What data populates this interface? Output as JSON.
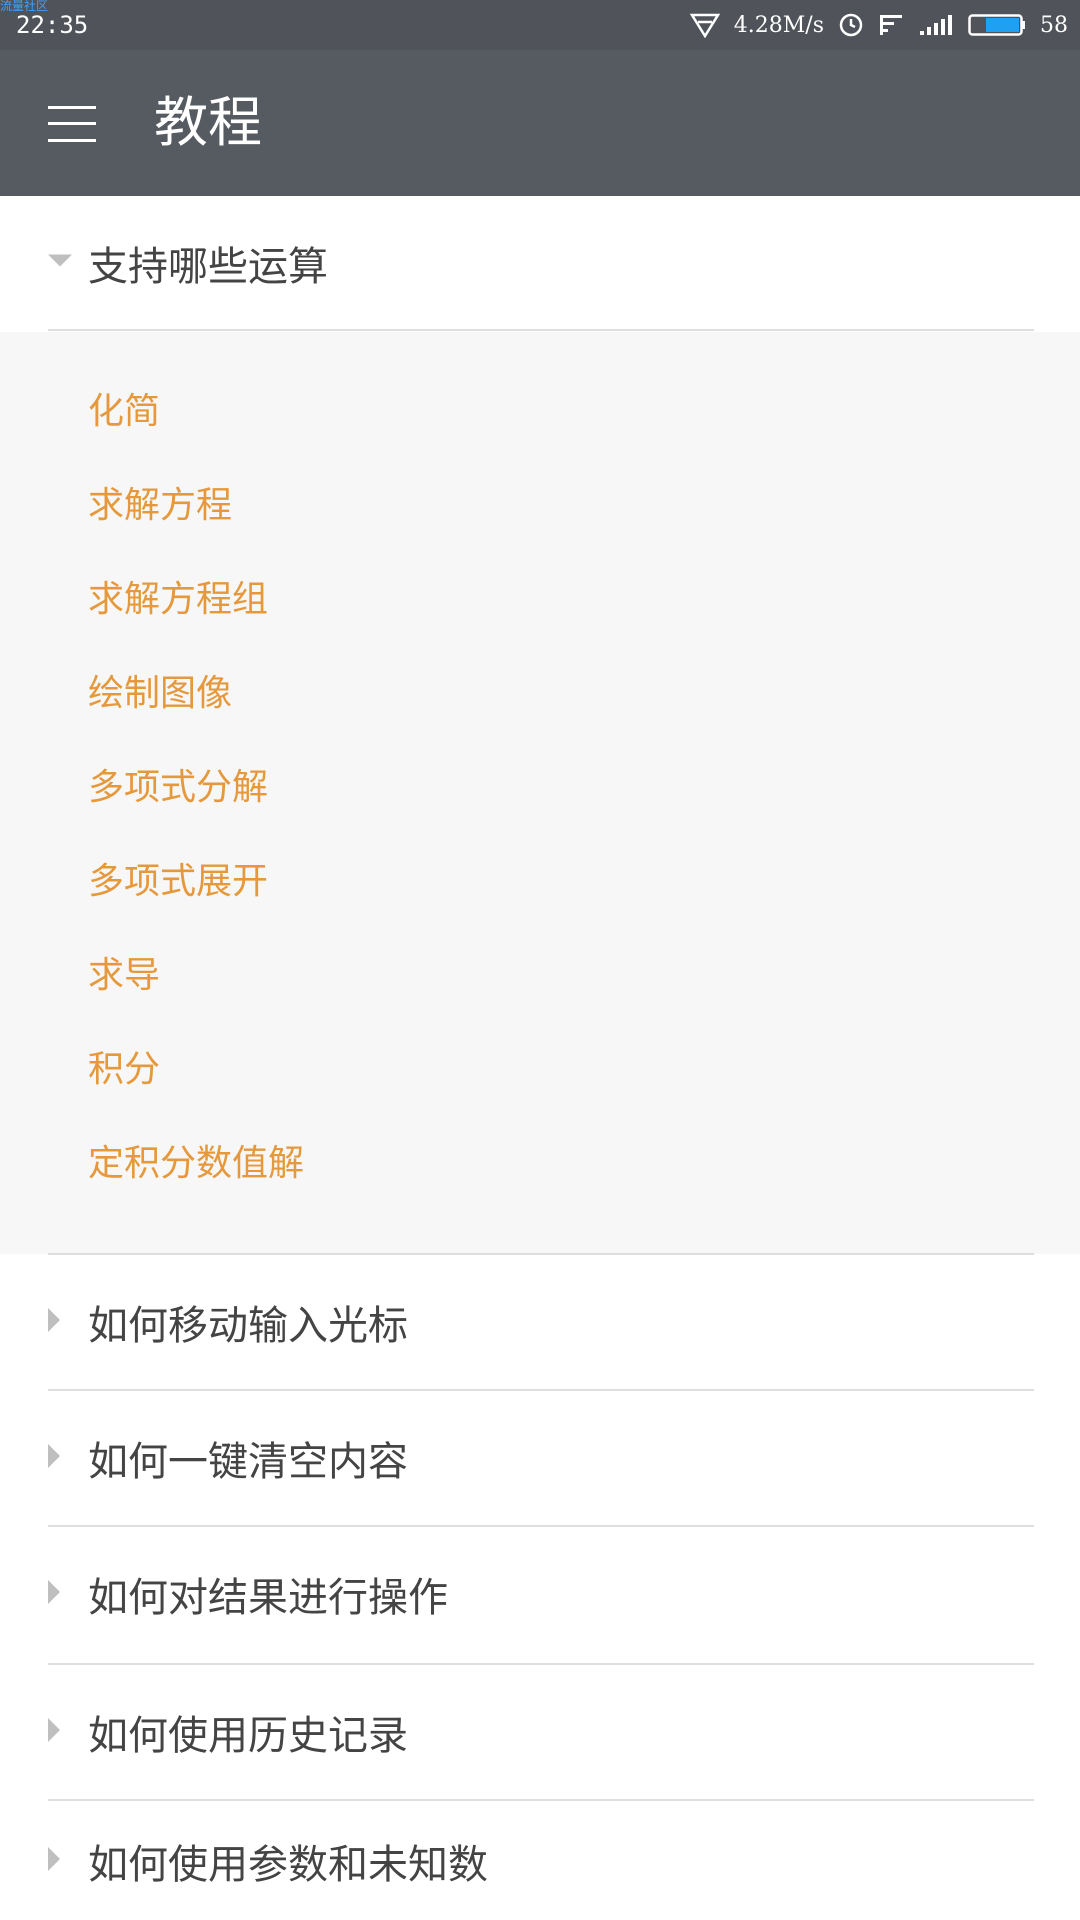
{
  "status_bar": {
    "watermark": "流量社区",
    "time": "22:35",
    "net_speed": "4.28M/s",
    "battery": "58"
  },
  "app_bar": {
    "title": "教程",
    "menu_icon": "menu-icon"
  },
  "sections": [
    {
      "label": "支持哪些运算",
      "expanded": true,
      "items": [
        "化简",
        "求解方程",
        "求解方程组",
        "绘制图像",
        "多项式分解",
        "多项式展开",
        "求导",
        "积分",
        "定积分数值解"
      ]
    },
    {
      "label": "如何移动输入光标",
      "expanded": false
    },
    {
      "label": "如何一键清空内容",
      "expanded": false
    },
    {
      "label": "如何对结果进行操作",
      "expanded": false
    },
    {
      "label": "如何使用历史记录",
      "expanded": false
    },
    {
      "label": "如何使用参数和未知数",
      "expanded": false
    }
  ],
  "colors": {
    "app_bar": "#565b62",
    "status_bar": "#50545a",
    "accent": "#e6993c",
    "text": "#444444",
    "panel": "#f7f7f7",
    "battery": "#1fa0f0"
  }
}
